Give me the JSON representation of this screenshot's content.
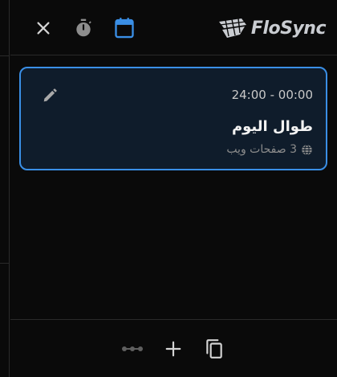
{
  "header": {
    "icons": {
      "close": "close-icon",
      "timer": "stopwatch-icon",
      "calendar": "calendar-icon"
    },
    "brand": "FloSync"
  },
  "card": {
    "time_range": "24:00 - 00:00",
    "title": "طوال اليوم",
    "meta": "3 صفحات ويب",
    "icons": {
      "edit": "pencil-icon",
      "meta": "globe-icon"
    }
  },
  "toolbar": {
    "icons": [
      "link-icon",
      "plus-icon",
      "copy-icon"
    ]
  },
  "colors": {
    "background": "#0a0a0a",
    "accent": "#3a8fe6",
    "card_bg": "#0f1c2b",
    "icon": "#c8c8c8",
    "muted": "#8c8c8c"
  }
}
